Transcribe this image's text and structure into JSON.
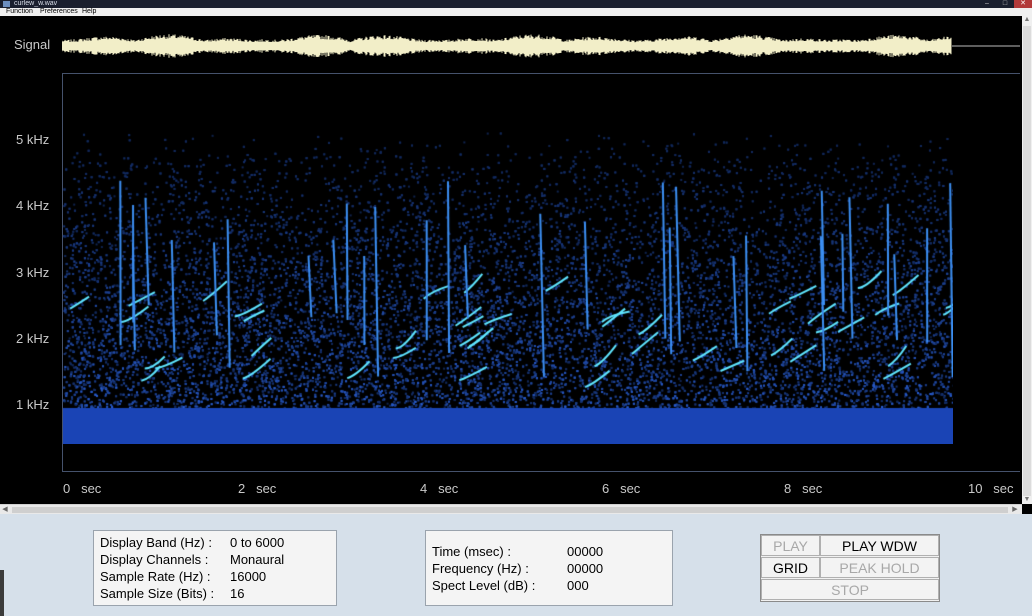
{
  "window": {
    "title": "curlew_w.wav"
  },
  "menu": {
    "items": [
      "Function",
      "Preferences",
      "Help"
    ]
  },
  "window_controls": [
    "–",
    "□",
    "✕"
  ],
  "signal": {
    "label": "Signal",
    "waveform_color": "#f2eec8"
  },
  "spectrogram": {
    "y_labels": [
      "5 kHz",
      "4 kHz",
      "3 kHz",
      "2 kHz",
      "1 kHz"
    ],
    "x_labels": [
      "0   sec",
      "2   sec",
      "4   sec",
      "6   sec",
      "8   sec",
      "10   sec"
    ],
    "colors": {
      "background": "#000000",
      "noise": "#1f4fc0",
      "trace": "#5fe6ff"
    }
  },
  "display_info": {
    "rows": [
      {
        "label": "Display Band (Hz) :",
        "value": "0 to 6000"
      },
      {
        "label": "Display Channels :",
        "value": "Monaural"
      },
      {
        "label": "Sample Rate (Hz) :",
        "value": "16000"
      },
      {
        "label": "Sample Size (Bits) :",
        "value": "16"
      }
    ]
  },
  "cursor_info": {
    "rows": [
      {
        "label": "Time (msec) :",
        "value": "00000"
      },
      {
        "label": "Frequency (Hz) :",
        "value": "00000"
      },
      {
        "label": "Spect Level (dB) :",
        "value": "000"
      }
    ]
  },
  "controls": {
    "play": "PLAY",
    "play_wdw": "PLAY WDW",
    "grid": "GRID",
    "peak_hold": "PEAK HOLD",
    "stop": "STOP"
  }
}
